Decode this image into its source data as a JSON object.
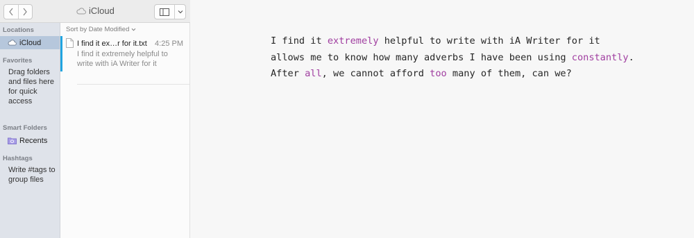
{
  "window": {
    "title": "iCloud"
  },
  "toolbar": {
    "back_icon": "chevron-left-icon",
    "forward_icon": "chevron-right-icon",
    "view_icon": "sidebar-icon",
    "menu_icon": "chevron-down-icon"
  },
  "sidebar": {
    "locations_header": "Locations",
    "icloud_label": "iCloud",
    "favorites_header": "Favorites",
    "favorites_note": "Drag folders and files here for quick access",
    "smart_folders_header": "Smart Folders",
    "recents_label": "Recents",
    "hashtags_header": "Hashtags",
    "hashtags_note": "Write #tags to group files"
  },
  "file_list": {
    "sort_label": "Sort by Date Modified",
    "files": [
      {
        "name": "I find it ex…r for it.txt",
        "time": "4:25 PM",
        "preview": "I find it extremely helpful to write with iA Writer for it"
      }
    ]
  },
  "editor": {
    "line1": {
      "a": "I find it ",
      "adv1": "extremely",
      "b": " helpful to write with iA Writer for it"
    },
    "line2": {
      "a": "allows me to know how many adverbs I have been using ",
      "adv1": "constantly",
      "b": "."
    },
    "line3": {
      "a": "After ",
      "adv1": "all",
      "b": ", we cannot afford ",
      "adv2": "too",
      "c": " many of them, can we?"
    }
  },
  "colors": {
    "adverb_highlight": "#a03ea0",
    "selection_accent": "#20a4e0",
    "sidebar_selected": "#b6c7dc"
  }
}
